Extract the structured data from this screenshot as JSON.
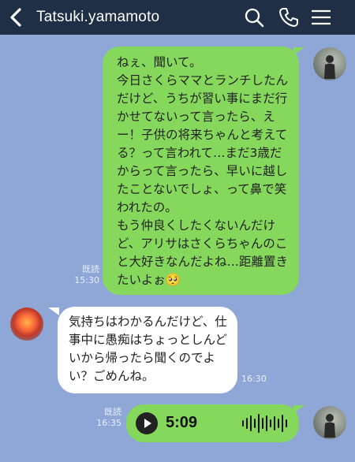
{
  "header": {
    "title": "Tatsuki.yamamoto",
    "back_icon": "chevron-left-icon",
    "search_icon": "search-icon",
    "call_icon": "phone-icon",
    "menu_icon": "menu-icon",
    "bg_color": "#1f2f45"
  },
  "chat": {
    "background_color": "#8fa7d6",
    "messages": [
      {
        "sender": "me",
        "text": "ねぇ、聞いて。\n今日さくらママとランチしたんだけど、うちが習い事にまだ行かせてないって言ったら、えー！子供の将来ちゃんと考えてる？って言われて…まだ3歳だからって言ったら、早いに越したことないでしょ、って鼻で笑われたの。\nもう仲良くしたくないんだけど、アリサはさくらちゃんのこと大好きなんだよね…距離置きたいよぉ🥺",
        "read": "既読",
        "time": "15:30"
      },
      {
        "sender": "other",
        "text": "気持ちはわかるんだけど、仕事中に愚痴はちょっとしんどいから帰ったら聞くのでよい？ごめんね。",
        "time": "16:30"
      },
      {
        "sender": "me",
        "type": "voice",
        "duration": "5:09",
        "read": "既読",
        "time": "16:35"
      }
    ]
  }
}
